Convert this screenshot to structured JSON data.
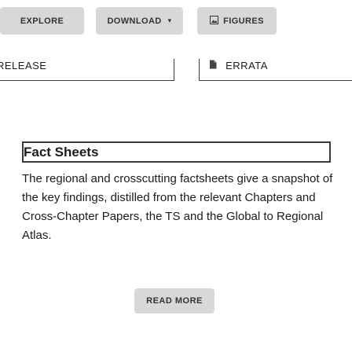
{
  "toolbar": {
    "explore_label": "EXPLORE",
    "download_label": "DOWNLOAD",
    "download_chevron": "⌄",
    "figures_label": "FIGURES",
    "figures_icon": "image-icon"
  },
  "tabs": {
    "release_label": "RELEASE",
    "errata_label": "ERRATA",
    "errata_icon": "document-icon"
  },
  "card": {
    "title": "Fact Sheets",
    "description": "The regional and crosscutting factsheets give a snapshot of the key findings, distilled from the relevant Chapters and Cross-Chapter Papers, the TS and the Global to Regional Atlas.",
    "read_more_label": "READ MORE"
  }
}
